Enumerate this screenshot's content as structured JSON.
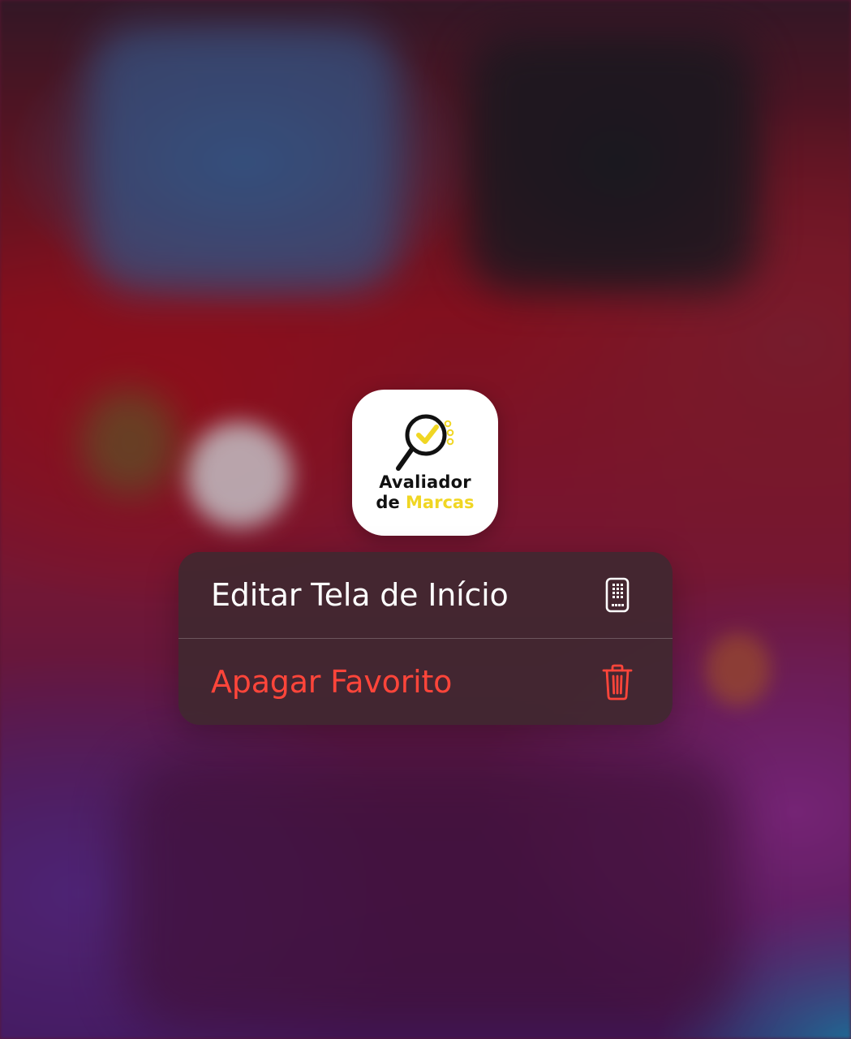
{
  "app": {
    "name_line1": "Avaliador",
    "name_line2_a": "de ",
    "name_line2_b": "Marcas",
    "accent_color": "#f0d623"
  },
  "context_menu": {
    "items": [
      {
        "label": "Editar Tela de Início",
        "icon": "phone-screen-icon",
        "color": "#ffffff"
      },
      {
        "label": "Apagar Favorito",
        "icon": "trash-icon",
        "color": "#ff453a"
      }
    ]
  }
}
